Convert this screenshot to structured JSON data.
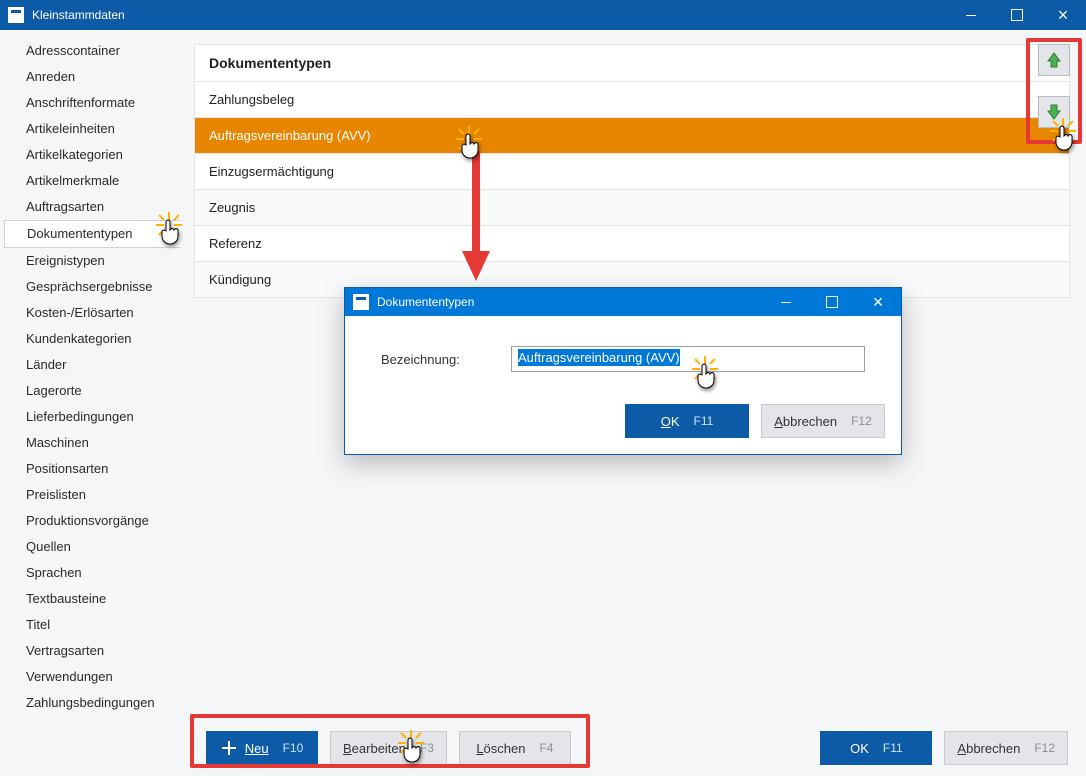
{
  "window": {
    "title": "Kleinstammdaten"
  },
  "sidebar": {
    "items": [
      {
        "label": "Adresscontainer"
      },
      {
        "label": "Anreden"
      },
      {
        "label": "Anschriftenformate"
      },
      {
        "label": "Artikeleinheiten"
      },
      {
        "label": "Artikelkategorien"
      },
      {
        "label": "Artikelmerkmale"
      },
      {
        "label": "Auftragsarten"
      },
      {
        "label": "Dokumententypen",
        "selected": true
      },
      {
        "label": "Ereignistypen"
      },
      {
        "label": "Gesprächsergebnisse"
      },
      {
        "label": "Kosten-/Erlösarten"
      },
      {
        "label": "Kundenkategorien"
      },
      {
        "label": "Länder"
      },
      {
        "label": "Lagerorte"
      },
      {
        "label": "Lieferbedingungen"
      },
      {
        "label": "Maschinen"
      },
      {
        "label": "Positionsarten"
      },
      {
        "label": "Preislisten"
      },
      {
        "label": "Produktionsvorgänge"
      },
      {
        "label": "Quellen"
      },
      {
        "label": "Sprachen"
      },
      {
        "label": "Textbausteine"
      },
      {
        "label": "Titel"
      },
      {
        "label": "Vertragsarten"
      },
      {
        "label": "Verwendungen"
      },
      {
        "label": "Zahlungsbedingungen"
      }
    ]
  },
  "list": {
    "header": "Dokumententypen",
    "rows": [
      {
        "label": "Zahlungsbeleg"
      },
      {
        "label": "Auftragsvereinbarung (AVV)",
        "selected": true
      },
      {
        "label": "Einzugsermächtigung"
      },
      {
        "label": "Zeugnis"
      },
      {
        "label": "Referenz"
      },
      {
        "label": "Kündigung"
      }
    ]
  },
  "footer": {
    "neu_label": "Neu",
    "neu_key": "F10",
    "bearbeiten_label": "Bearbeiten",
    "bearbeiten_key": "F3",
    "loeschen_label": "Löschen",
    "loeschen_key": "F4",
    "ok_label": "OK",
    "ok_key": "F11",
    "abbrechen_label": "Abbrechen",
    "abbrechen_key": "F12"
  },
  "dialog": {
    "title": "Dokumententypen",
    "field_label": "Bezeichnung:",
    "field_value": "Auftragsvereinbarung (AVV)",
    "ok_label": "OK",
    "ok_key": "F11",
    "abbrechen_label": "Abbrechen",
    "abbrechen_key": "F12"
  },
  "colors": {
    "accent": "#0d5aa7",
    "selection_row": "#e88600",
    "highlight": "#e53935",
    "arrow_green": "#4caf50"
  }
}
